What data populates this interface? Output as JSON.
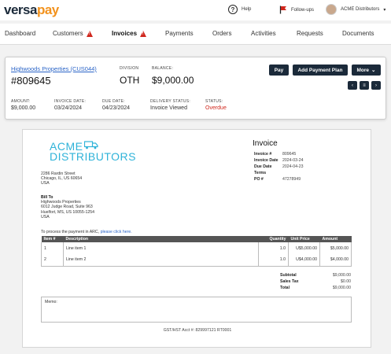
{
  "brand": {
    "logo_main": "versa",
    "logo_accent": "pay",
    "accent_color": "#f2921d",
    "navy": "#1b2a3a"
  },
  "topbar": {
    "help_label": "Help",
    "followups_label": "Follow-ups",
    "user_name": "ACME Distributors"
  },
  "nav": {
    "items": [
      {
        "label": "Dashboard"
      },
      {
        "label": "Customers"
      },
      {
        "label": "Invoices"
      },
      {
        "label": "Payments"
      },
      {
        "label": "Orders"
      },
      {
        "label": "Activities"
      },
      {
        "label": "Requests"
      },
      {
        "label": "Documents"
      }
    ],
    "active": "Invoices",
    "warning_color": "#d0271d"
  },
  "summary": {
    "customer_link": "Highwoods Properties (CUS044)",
    "invoice_number": "#809645",
    "division_label": "DIVISION",
    "division_value": "OTH",
    "balance_label": "BALANCE:",
    "balance_value": "$9,000.00",
    "buttons": {
      "pay": "Pay",
      "add_plan": "Add Payment Plan",
      "more": "More"
    },
    "fields": {
      "amount_label": "AMOUNT:",
      "amount_value": "$9,000.00",
      "invoice_date_label": "INVOICE DATE:",
      "invoice_date_value": "03/24/2024",
      "due_date_label": "DUE DATE:",
      "due_date_value": "04/23/2024",
      "delivery_label": "DELIVERY STATUS:",
      "delivery_value": "Invoice Viewed",
      "status_label": "STATUS:",
      "status_value": "Overdue"
    }
  },
  "document": {
    "company_logo_line1": "ACME",
    "company_logo_line2": "DISTRIBUTORS",
    "company_address": [
      "2286 Rardin Street",
      "Chicago, IL, US 60654",
      "USA"
    ],
    "bill_to_label": "Bill To",
    "bill_to": [
      "Highwoods Properties",
      "6012 Judge Road, Suite 963",
      "Huelfort, MS, US 10055-1254",
      "USA"
    ],
    "title": "Invoice",
    "meta": [
      {
        "k": "Invoice #",
        "v": "809645"
      },
      {
        "k": "Invoice Date",
        "v": "2024-03-24"
      },
      {
        "k": "Due Date",
        "v": "2024-04-23"
      },
      {
        "k": "Terms",
        "v": ""
      },
      {
        "k": "PO #",
        "v": "47278949"
      }
    ],
    "pay_text": "To process the payment in ARC,",
    "pay_link": "please click here.",
    "table": {
      "headers": {
        "item": "Item #",
        "description": "Description",
        "quantity": "Quantity",
        "unit_price": "Unit Price",
        "amount": "Amount"
      },
      "rows": [
        {
          "item": "1",
          "description": "Line item 1",
          "quantity": "1.0",
          "unit_price": "U$5,000.00",
          "amount": "$5,000.00"
        },
        {
          "item": "2",
          "description": "Line item 2",
          "quantity": "1.0",
          "unit_price": "U$4,000.00",
          "amount": "$4,000.00"
        }
      ]
    },
    "totals": [
      {
        "k": "Subtotal",
        "v": "$9,000.00"
      },
      {
        "k": "Sales Tax",
        "v": "$0.00"
      },
      {
        "k": "Total",
        "v": "$9,000.00"
      }
    ],
    "memo_label": "Memo:",
    "gst_line": "GST/HST Acct #: 829997121 RT0001"
  }
}
